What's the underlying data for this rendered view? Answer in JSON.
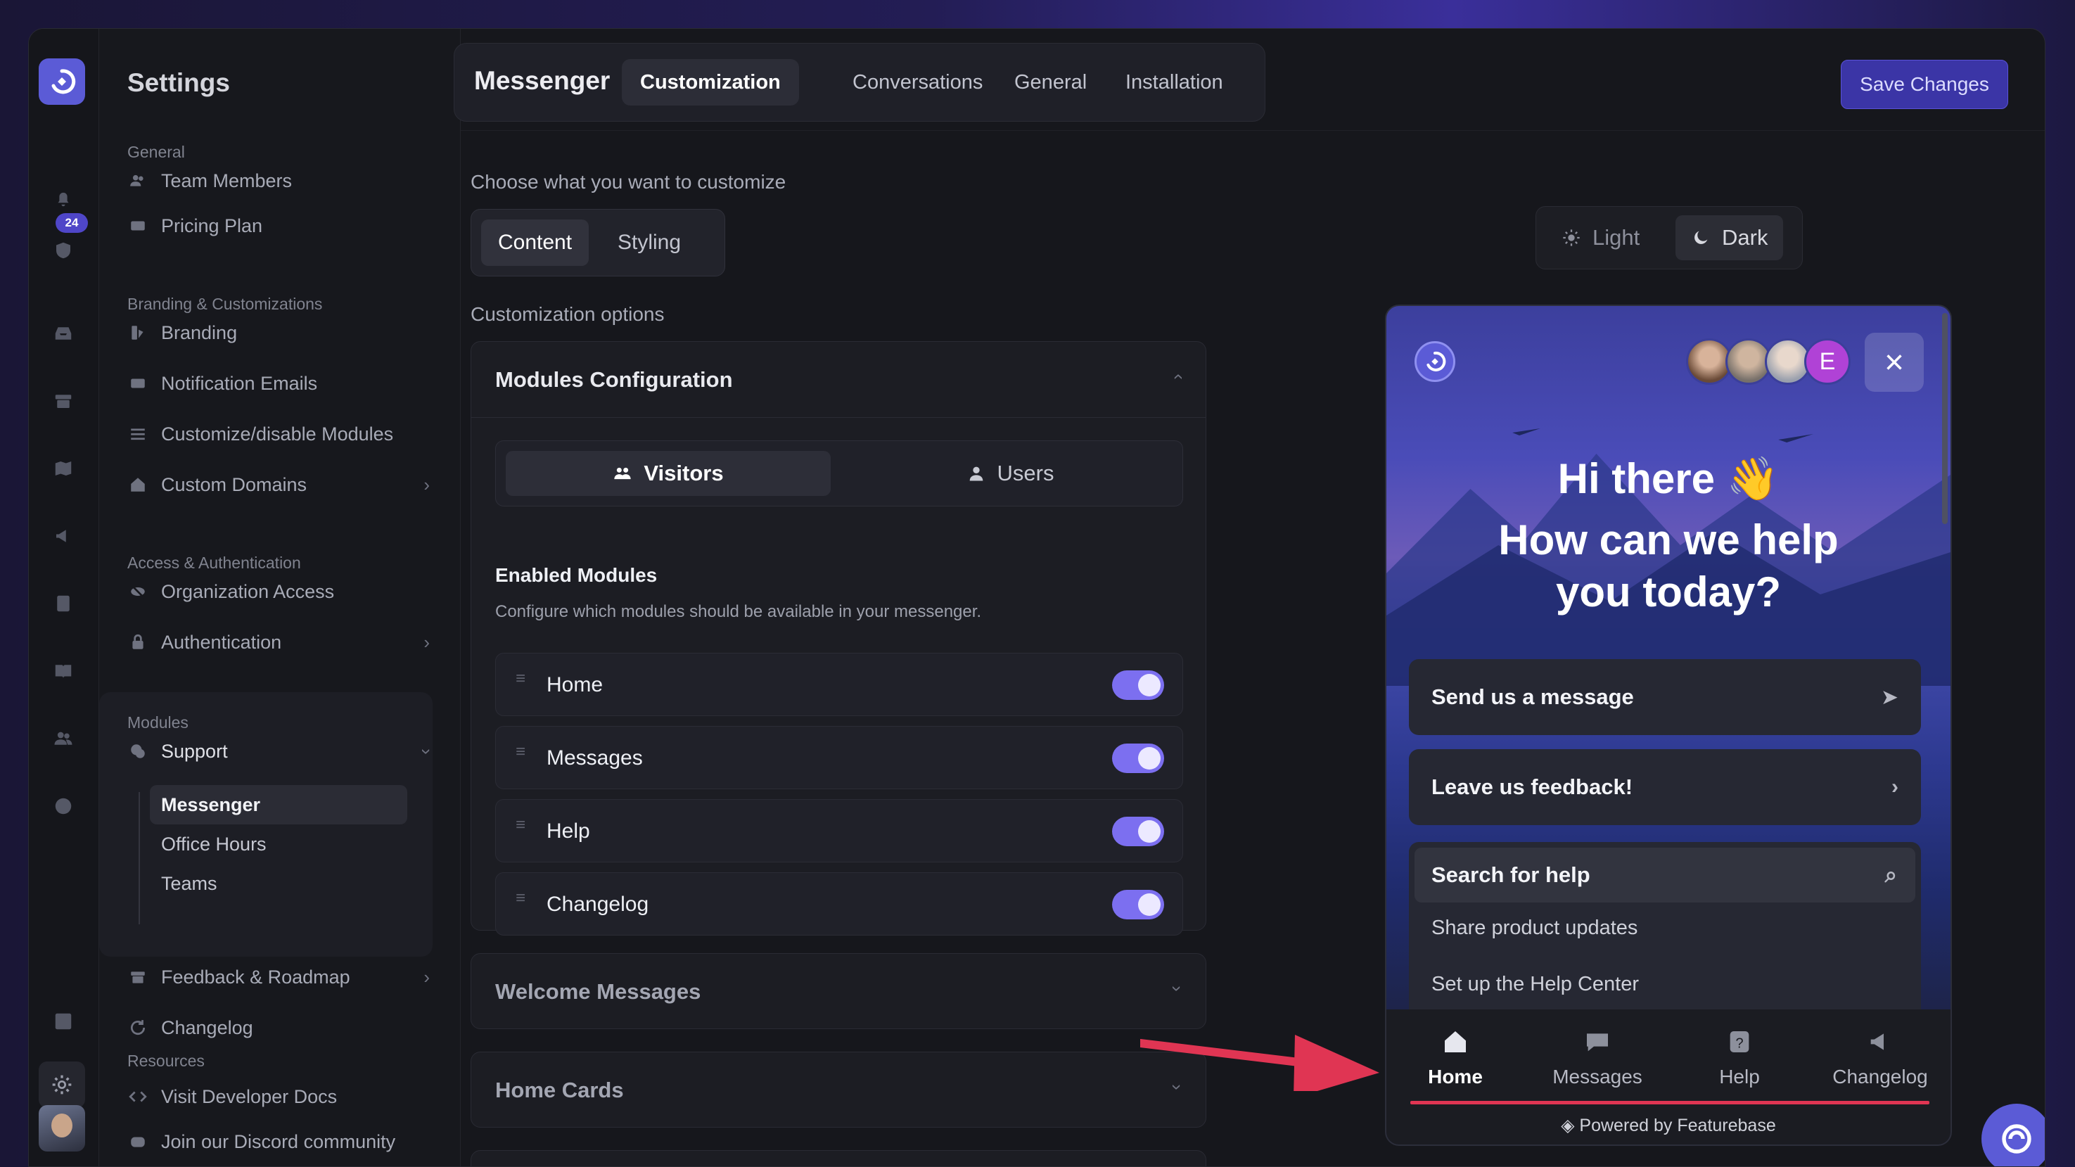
{
  "sidebar": {
    "title": "Settings",
    "badge": "24",
    "sections": {
      "general": "General",
      "branding": "Branding & Customizations",
      "access": "Access & Authentication",
      "modules": "Modules",
      "resources": "Resources"
    },
    "items": {
      "team_members": "Team Members",
      "pricing_plan": "Pricing Plan",
      "branding": "Branding",
      "notification_emails": "Notification Emails",
      "customize_modules": "Customize/disable Modules",
      "custom_domains": "Custom Domains",
      "organization_access": "Organization Access",
      "authentication": "Authentication",
      "support": "Support",
      "messenger": "Messenger",
      "office_hours": "Office Hours",
      "teams": "Teams",
      "feedback_roadmap": "Feedback & Roadmap",
      "changelog": "Changelog",
      "developer_docs": "Visit Developer Docs",
      "discord": "Join our Discord community"
    }
  },
  "header": {
    "brand": "Messenger",
    "tabs": [
      "Customization",
      "Conversations",
      "General",
      "Installation"
    ],
    "active_tab": "Customization",
    "save_label": "Save Changes"
  },
  "main": {
    "choose_label": "Choose what you want to customize",
    "content_tabs": [
      "Content",
      "Styling"
    ],
    "options_label": "Customization options",
    "modules_card": {
      "title": "Modules Configuration",
      "audience_tabs": [
        "Visitors",
        "Users"
      ],
      "enabled_title": "Enabled Modules",
      "enabled_desc": "Configure which modules should be available in your messenger.",
      "modules": [
        {
          "label": "Home",
          "enabled": true
        },
        {
          "label": "Messages",
          "enabled": true
        },
        {
          "label": "Help",
          "enabled": true
        },
        {
          "label": "Changelog",
          "enabled": true
        }
      ]
    },
    "welcome_title": "Welcome Messages",
    "home_cards_title": "Home Cards"
  },
  "preview": {
    "modes": [
      "Light",
      "Dark"
    ],
    "active_mode": "Dark",
    "avatar_letter": "E",
    "greeting_line1": "Hi there 👋",
    "greeting_line2": "How can we help you today?",
    "send_message": "Send us a message",
    "leave_feedback": "Leave us feedback!",
    "search_placeholder": "Search for help",
    "suggestions": [
      "Share product updates",
      "Set up the Help Center"
    ],
    "nav_tabs": [
      "Home",
      "Messages",
      "Help",
      "Changelog"
    ],
    "powered_by": "Powered by Featurebase"
  },
  "colors": {
    "accent": "#5b5bd6",
    "toggle_on": "#7c6ff0",
    "highlight_red": "#e03553"
  }
}
